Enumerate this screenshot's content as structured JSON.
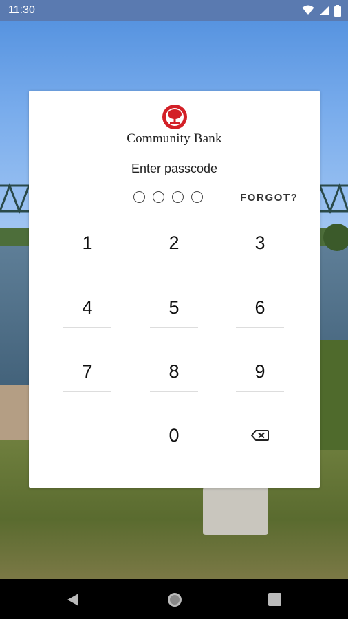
{
  "status_bar": {
    "time": "11:30",
    "icons": [
      "wifi-icon",
      "signal-icon",
      "battery-icon"
    ]
  },
  "logo": {
    "text": "Community Bank",
    "accent_color": "#d32027"
  },
  "prompt": "Enter passcode",
  "passcode_length": 4,
  "forgot_label": "FORGOT?",
  "keypad": {
    "keys": [
      "1",
      "2",
      "3",
      "4",
      "5",
      "6",
      "7",
      "8",
      "9",
      "0"
    ],
    "backspace_icon": "backspace-icon"
  },
  "nav_bar": {
    "buttons": [
      "back-icon",
      "home-icon",
      "recents-icon"
    ]
  }
}
